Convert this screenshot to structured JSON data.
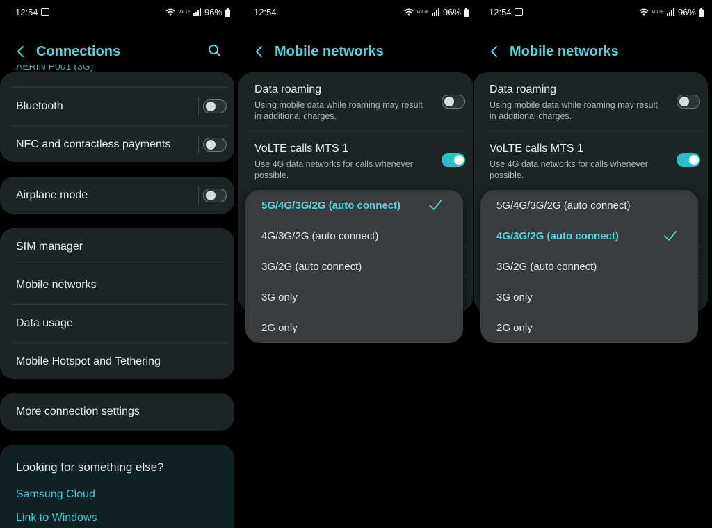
{
  "status": {
    "time": "12:54",
    "volte_text": "VoLTE",
    "battery": "96%"
  },
  "screen1": {
    "title": "Connections",
    "partial_item": "AERIN P001 (3G)",
    "items_card1": [
      {
        "label": "Bluetooth",
        "toggle": false
      },
      {
        "label": "NFC and contactless payments",
        "toggle": false
      }
    ],
    "airplane": {
      "label": "Airplane mode",
      "toggle": false
    },
    "items_card3": [
      {
        "label": "SIM manager"
      },
      {
        "label": "Mobile networks"
      },
      {
        "label": "Data usage"
      },
      {
        "label": "Mobile Hotspot and Tethering"
      }
    ],
    "more": "More connection settings",
    "looking": {
      "heading": "Looking for something else?",
      "links": [
        "Samsung Cloud",
        "Link to Windows"
      ]
    }
  },
  "screen2": {
    "title": "Mobile networks",
    "data_roaming": {
      "title": "Data roaming",
      "subtitle": "Using mobile data while roaming may result in additional charges.",
      "toggle": false
    },
    "volte": {
      "title": "VoLTE calls MTS 1",
      "subtitle": "Use 4G data networks for calls whenever possible.",
      "toggle": true
    },
    "options": [
      "5G/4G/3G/2G (auto connect)",
      "4G/3G/2G (auto connect)",
      "3G/2G (auto connect)",
      "3G only",
      "2G only"
    ],
    "selected_index": 0
  },
  "screen3": {
    "title": "Mobile networks",
    "data_roaming": {
      "title": "Data roaming",
      "subtitle": "Using mobile data while roaming may result in additional charges.",
      "toggle": false
    },
    "volte": {
      "title": "VoLTE calls MTS 1",
      "subtitle": "Use 4G data networks for calls whenever possible.",
      "toggle": true
    },
    "options": [
      "5G/4G/3G/2G (auto connect)",
      "4G/3G/2G (auto connect)",
      "3G/2G (auto connect)",
      "3G only",
      "2G only"
    ],
    "selected_index": 1
  },
  "colors": {
    "accent": "#4fd7dd",
    "card": "#1c2426",
    "dropdown": "#3a3b3c",
    "toggle_on": "#2bbfc7"
  }
}
